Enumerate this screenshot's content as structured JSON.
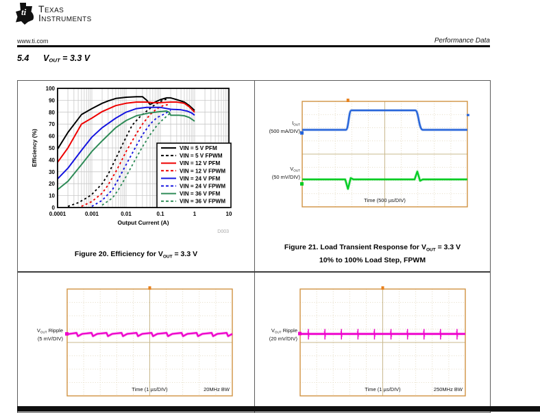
{
  "page": {
    "brand": {
      "line1": "Texas",
      "line2": "Instruments"
    },
    "header": {
      "left": "www.ti.com",
      "right": "Performance Data"
    },
    "section": {
      "number": "5.4",
      "title_seg": [
        {
          "t": "V"
        },
        {
          "t": "OUT",
          "sub": true
        },
        {
          "t": " = 3.3 V"
        }
      ]
    },
    "captions": {
      "fig20_seg": [
        {
          "t": "Figure 20. Efficiency for V"
        },
        {
          "t": "OUT",
          "sub": true
        },
        {
          "t": " = 3.3 V"
        }
      ],
      "fig21_line1_seg": [
        {
          "t": "Figure 21. Load Transient Response for V"
        },
        {
          "t": "OUT",
          "sub": true
        },
        {
          "t": " = 3.3 V"
        }
      ],
      "fig21_line2_seg": [
        {
          "t": "10% to 100% Load Step, FPWM"
        }
      ]
    }
  },
  "colors": {
    "pfm5": "#000000",
    "pfm12": "#ee0000",
    "pfm24": "#1414e0",
    "pfm36": "#2e8b57",
    "scope_border": "#cf9240",
    "scope_grid": "#dccfb0",
    "scope_center": "#c9b88e",
    "trigger": "#e8821e",
    "iout_trace": "#2563d9",
    "vout_trace": "#00cc22",
    "ripple_trace": "#ee00cc"
  },
  "chart_data": [
    {
      "id": "efficiency",
      "type": "line",
      "xlabel": "Output Current (A)",
      "ylabel": "Efficiency (%)",
      "xscale": "log",
      "xlim": [
        0.0001,
        10
      ],
      "ylim": [
        0,
        100
      ],
      "xtick_labels": [
        "0.0001",
        "0.001",
        "0.01",
        "0.1",
        "1",
        "10"
      ],
      "yticks": [
        0,
        10,
        20,
        30,
        40,
        50,
        60,
        70,
        80,
        90,
        100
      ],
      "grid": true,
      "legend_position": "lower right",
      "watermark": "D003",
      "series": [
        {
          "label": "VIN = 5 V  PFM",
          "color": "#000000",
          "dash": false,
          "points": [
            [
              0.0001,
              49
            ],
            [
              0.0002,
              63
            ],
            [
              0.0005,
              78
            ],
            [
              0.001,
              83
            ],
            [
              0.002,
              87.5
            ],
            [
              0.003,
              89.5
            ],
            [
              0.005,
              91.5
            ],
            [
              0.01,
              92.5
            ],
            [
              0.02,
              93
            ],
            [
              0.03,
              93
            ],
            [
              0.04,
              90
            ],
            [
              0.05,
              86.5
            ],
            [
              0.07,
              88.5
            ],
            [
              0.1,
              90.5
            ],
            [
              0.15,
              92
            ],
            [
              0.2,
              92
            ],
            [
              0.3,
              90.5
            ],
            [
              0.5,
              88.5
            ],
            [
              0.7,
              85.5
            ],
            [
              1,
              81.5
            ]
          ]
        },
        {
          "label": "VIN = 5 V  FPWM",
          "color": "#000000",
          "dash": true,
          "points": [
            [
              0.0002,
              1
            ],
            [
              0.0004,
              4
            ],
            [
              0.0007,
              8
            ],
            [
              0.001,
              11
            ],
            [
              0.002,
              20
            ],
            [
              0.003,
              28
            ],
            [
              0.005,
              41
            ],
            [
              0.007,
              50
            ],
            [
              0.01,
              59
            ],
            [
              0.015,
              69
            ],
            [
              0.02,
              73
            ],
            [
              0.025,
              76
            ],
            [
              0.04,
              81
            ],
            [
              0.06,
              85
            ],
            [
              0.1,
              89
            ],
            [
              0.15,
              91
            ]
          ]
        },
        {
          "label": "VIN = 12 V PFM",
          "color": "#ee0000",
          "dash": false,
          "points": [
            [
              0.0001,
              38
            ],
            [
              0.0002,
              50
            ],
            [
              0.0005,
              70
            ],
            [
              0.001,
              75
            ],
            [
              0.002,
              80.5
            ],
            [
              0.005,
              85.5
            ],
            [
              0.01,
              87.5
            ],
            [
              0.02,
              88.5
            ],
            [
              0.04,
              88.5
            ],
            [
              0.06,
              88
            ],
            [
              0.1,
              88
            ],
            [
              0.2,
              88.5
            ],
            [
              0.3,
              88.5
            ],
            [
              0.5,
              87.5
            ],
            [
              0.7,
              84.5
            ],
            [
              1,
              80
            ]
          ]
        },
        {
          "label": "VIN = 12 V FPWM",
          "color": "#ee0000",
          "dash": true,
          "points": [
            [
              0.0005,
              1
            ],
            [
              0.001,
              5
            ],
            [
              0.002,
              12
            ],
            [
              0.003,
              19
            ],
            [
              0.005,
              30
            ],
            [
              0.007,
              38
            ],
            [
              0.01,
              47
            ],
            [
              0.02,
              62
            ],
            [
              0.03,
              70
            ],
            [
              0.05,
              78
            ],
            [
              0.08,
              83
            ],
            [
              0.12,
              85.5
            ],
            [
              0.18,
              86.5
            ]
          ]
        },
        {
          "label": "VIN = 24 V PFM",
          "color": "#1414e0",
          "dash": false,
          "points": [
            [
              0.0001,
              24
            ],
            [
              0.0002,
              33
            ],
            [
              0.0005,
              48
            ],
            [
              0.001,
              59
            ],
            [
              0.002,
              67
            ],
            [
              0.005,
              75
            ],
            [
              0.01,
              80
            ],
            [
              0.02,
              83
            ],
            [
              0.04,
              84
            ],
            [
              0.07,
              84
            ],
            [
              0.1,
              84
            ],
            [
              0.2,
              82.5
            ],
            [
              0.4,
              82
            ],
            [
              0.6,
              81
            ],
            [
              0.8,
              79.5
            ],
            [
              1,
              77.5
            ]
          ]
        },
        {
          "label": "VIN = 24 V FPWM",
          "color": "#1414e0",
          "dash": true,
          "points": [
            [
              0.001,
              1
            ],
            [
              0.002,
              6
            ],
            [
              0.004,
              15
            ],
            [
              0.006,
              24
            ],
            [
              0.01,
              36
            ],
            [
              0.02,
              52
            ],
            [
              0.03,
              61
            ],
            [
              0.05,
              70
            ],
            [
              0.08,
              75.5
            ],
            [
              0.12,
              78
            ],
            [
              0.2,
              81.5
            ]
          ]
        },
        {
          "label": "VIN = 36 V PFM",
          "color": "#2e8b57",
          "dash": false,
          "points": [
            [
              0.0001,
              15
            ],
            [
              0.0002,
              22
            ],
            [
              0.0005,
              36
            ],
            [
              0.001,
              47
            ],
            [
              0.002,
              56
            ],
            [
              0.005,
              67
            ],
            [
              0.01,
              73
            ],
            [
              0.02,
              77
            ],
            [
              0.05,
              79.5
            ],
            [
              0.1,
              80.5
            ],
            [
              0.15,
              81
            ],
            [
              0.18,
              80
            ],
            [
              0.2,
              77.5
            ],
            [
              0.35,
              77.5
            ],
            [
              0.5,
              77
            ],
            [
              0.7,
              75.5
            ],
            [
              1,
              72.5
            ]
          ]
        },
        {
          "label": "VIN = 36 V FPWM",
          "color": "#2e8b57",
          "dash": true,
          "points": [
            [
              0.002,
              2
            ],
            [
              0.004,
              8
            ],
            [
              0.006,
              15
            ],
            [
              0.01,
              26
            ],
            [
              0.02,
              42
            ],
            [
              0.03,
              51
            ],
            [
              0.05,
              61
            ],
            [
              0.08,
              69
            ],
            [
              0.12,
              74
            ],
            [
              0.2,
              79.5
            ]
          ]
        }
      ]
    },
    {
      "id": "load-transient-scope",
      "type": "scope",
      "time_label": "Time (500 µs/DIV)",
      "trigger_frac": 0.277,
      "channels": [
        {
          "name": "IOUT",
          "label_seg": [
            {
              "t": "I"
            },
            {
              "t": "OUT",
              "sub": true
            }
          ],
          "scale": "(500 mA/DIV)",
          "color": "#2563d9",
          "kind": "step",
          "base": 0.27,
          "high": 0.085,
          "up": 0.277,
          "down": 0.697
        },
        {
          "name": "VOUT",
          "label_seg": [
            {
              "t": "V"
            },
            {
              "t": "OUT",
              "sub": true
            }
          ],
          "scale": "(50 mV/DIV)",
          "color": "#00cc22",
          "kind": "transient",
          "base": 0.74,
          "dip_at": 0.277,
          "dip_amp": 0.09,
          "peak_at": 0.697,
          "peak_amp": 0.075
        }
      ]
    },
    {
      "id": "ripple-scope-20mhz",
      "type": "scope",
      "time_label": "Time (1 µs/DIV)",
      "bw_label": "20MHz BW",
      "trigger_frac": 0.5,
      "channels": [
        {
          "name": "VOUT Ripple",
          "label_seg": [
            {
              "t": "V"
            },
            {
              "t": "OUT",
              "sub": true
            },
            {
              "t": " Ripple"
            }
          ],
          "scale": "(5 mV/DIV)",
          "color": "#ee00cc",
          "kind": "ripple",
          "base": 0.423,
          "periods": 11,
          "rise_amp": 0.013,
          "notch_amp": 0.018
        }
      ]
    },
    {
      "id": "ripple-scope-250mhz",
      "type": "scope",
      "time_label": "Time (1 µs/DIV)",
      "bw_label": "250MHz BW",
      "trigger_frac": 0.5,
      "channels": [
        {
          "name": "VOUT Ripple",
          "label_seg": [
            {
              "t": "V"
            },
            {
              "t": "OUT",
              "sub": true
            },
            {
              "t": " Ripple"
            }
          ],
          "scale": "(20 mV/DIV)",
          "color": "#ee00cc",
          "kind": "spikes",
          "base": 0.42,
          "count": 10,
          "up_amp": 0.046,
          "down_amp": 0.052
        }
      ]
    }
  ]
}
